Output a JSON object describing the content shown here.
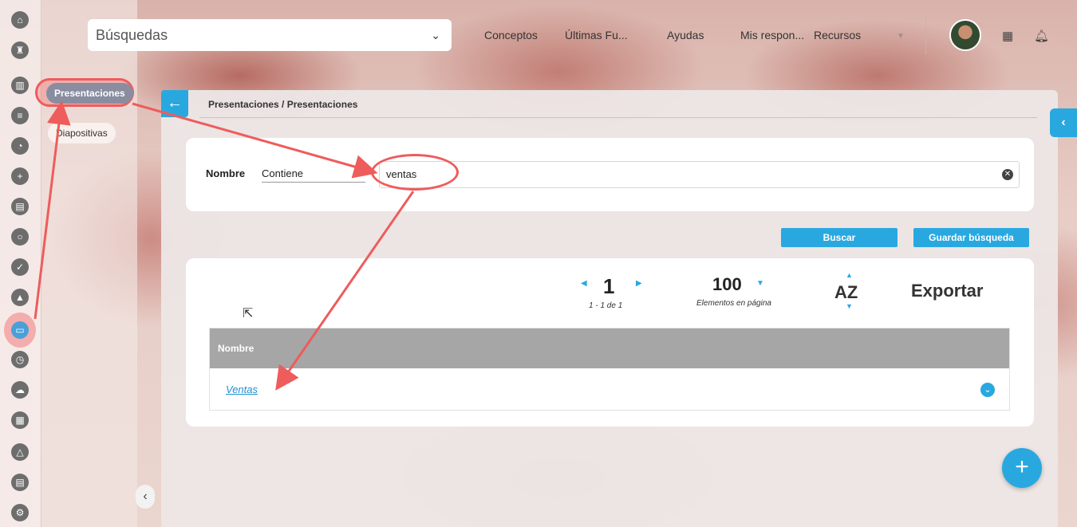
{
  "topbar": {
    "search_placeholder": "Búsquedas",
    "nav_items": [
      "Conceptos",
      "Últimas Fu...",
      "Ayudas",
      "Mis respon...",
      "Recursos"
    ]
  },
  "submenu": {
    "items": [
      {
        "label": "Presentaciones",
        "active": true
      },
      {
        "label": "Diapositivas",
        "active": false
      }
    ]
  },
  "breadcrumb": "Presentaciones / Presentaciones",
  "filter": {
    "field_label": "Nombre",
    "operator": "Contiene",
    "value": "ventas"
  },
  "actions": {
    "search": "Buscar",
    "save_search": "Guardar búsqueda"
  },
  "pager": {
    "page": "1",
    "range": "1 - 1 de 1",
    "per_page": "100",
    "per_page_label": "Elementos en página",
    "sort": "AZ",
    "export": "Exportar"
  },
  "table": {
    "column": "Nombre",
    "rows": [
      "Ventas"
    ]
  },
  "colors": {
    "accent": "#29a8e0",
    "annotation": "#ee5c5c"
  }
}
